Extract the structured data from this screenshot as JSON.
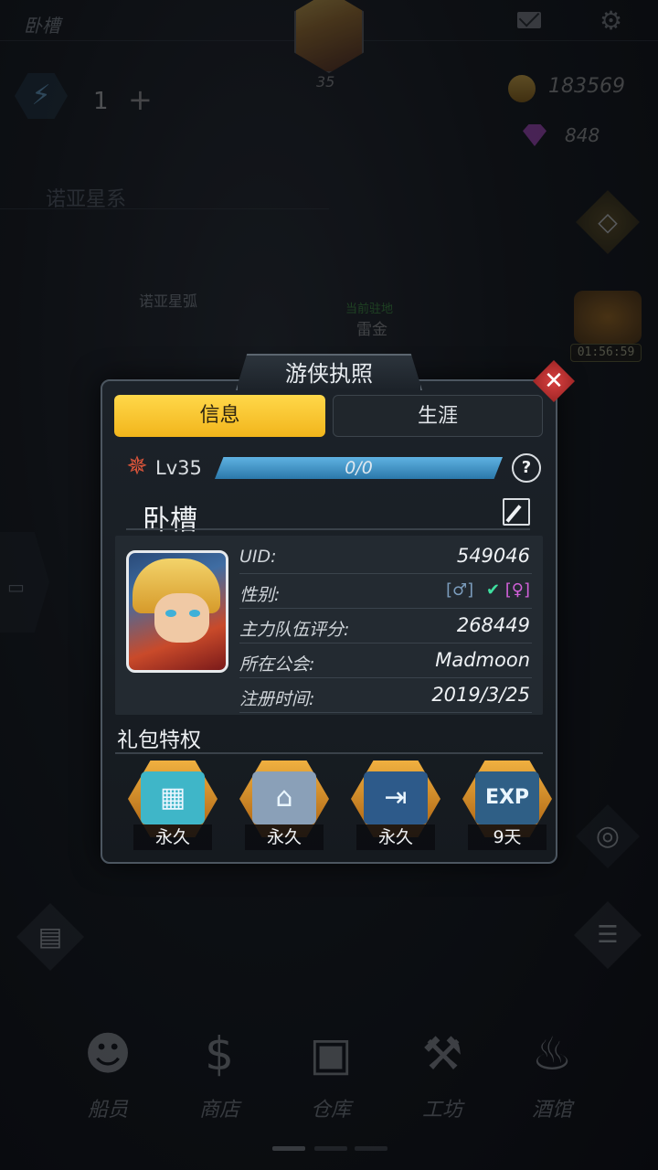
{
  "top": {
    "player_name": "卧槽",
    "player_level": "35",
    "energy": "1",
    "coins": "183569",
    "gems": "848",
    "event_timer": "01:56:59"
  },
  "map": {
    "sector": "诺亚星系",
    "arc": "诺亚星弧",
    "station_label": "当前驻地",
    "station_name": "雷金"
  },
  "bottom_nav": [
    {
      "label": "船员",
      "icon": "crew-icon"
    },
    {
      "label": "商店",
      "icon": "shop-icon"
    },
    {
      "label": "仓库",
      "icon": "warehouse-icon"
    },
    {
      "label": "工坊",
      "icon": "workshop-icon"
    },
    {
      "label": "酒馆",
      "icon": "tavern-icon"
    }
  ],
  "modal": {
    "title": "游侠执照",
    "close_glyph": "✕",
    "tabs": [
      {
        "label": "信息",
        "active": true
      },
      {
        "label": "生涯",
        "active": false
      }
    ],
    "level": "Lv35",
    "xp_text": "0/0",
    "xp_fraction": 1.0,
    "help_glyph": "?",
    "name": "卧槽",
    "info": {
      "uid_label": "UID:",
      "uid_value": "549046",
      "gender_label": "性别:",
      "gender_male": "[♂]",
      "gender_check": "✔",
      "gender_female": "[♀]",
      "score_label": "主力队伍评分:",
      "score_value": "268449",
      "guild_label": "所在公会:",
      "guild_value": "Madmoon",
      "reg_label": "注册时间:",
      "reg_value": "2019/3/25"
    },
    "perks_title": "礼包特权",
    "perks": [
      {
        "label": "永久",
        "icon": "clipboard-icon",
        "inner_color": "#3fb6c8"
      },
      {
        "label": "永久",
        "icon": "backpack-icon",
        "inner_color": "#8aa0b8"
      },
      {
        "label": "永久",
        "icon": "door-exit-icon",
        "inner_color": "#2d5a8a"
      },
      {
        "label": "9天",
        "icon": "exp-icon",
        "inner_color": "#2f5f86"
      }
    ]
  },
  "colors": {
    "accent_tab": "#f2b51b",
    "xp_bar": "#3a94c8",
    "close": "#c03030",
    "perk_frame": "#e0a030"
  }
}
